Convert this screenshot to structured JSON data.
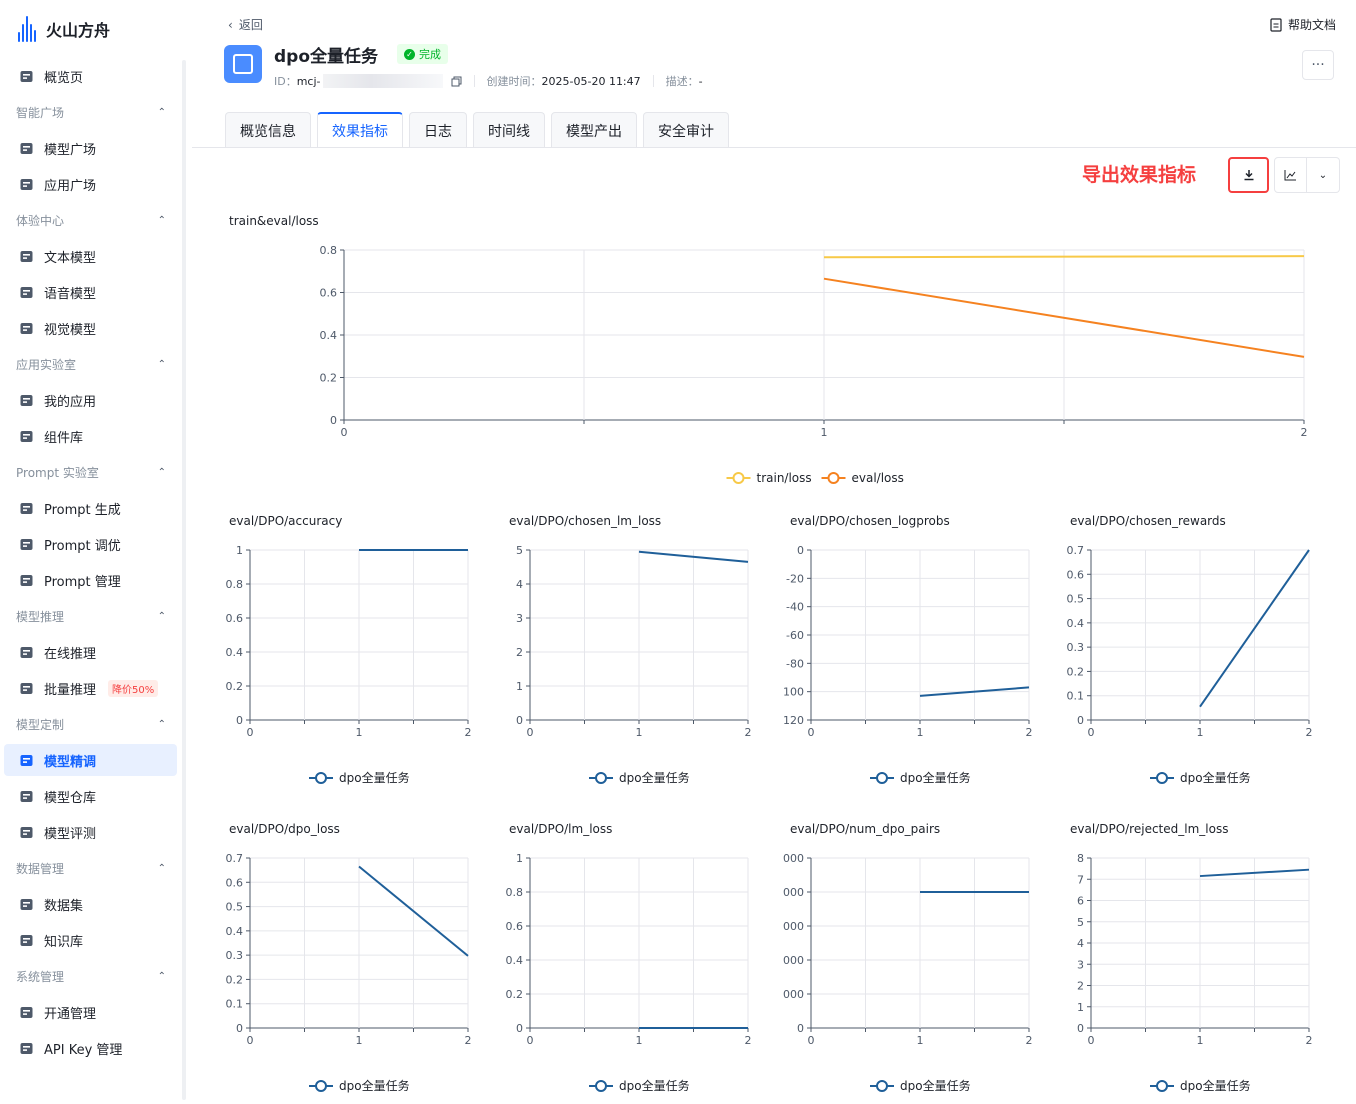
{
  "sidebar": {
    "logo_text": "火山方舟",
    "items": [
      {
        "type": "item",
        "label": "概览页",
        "icon": "dashboard-icon"
      },
      {
        "type": "group",
        "label": "智能广场"
      },
      {
        "type": "item",
        "label": "模型广场",
        "icon": "bulb-icon"
      },
      {
        "type": "item",
        "label": "应用广场",
        "icon": "atom-icon"
      },
      {
        "type": "group",
        "label": "体验中心"
      },
      {
        "type": "item",
        "label": "文本模型",
        "icon": "archive-icon"
      },
      {
        "type": "item",
        "label": "语音模型",
        "icon": "mic-icon"
      },
      {
        "type": "item",
        "label": "视觉模型",
        "icon": "camera-icon"
      },
      {
        "type": "group",
        "label": "应用实验室"
      },
      {
        "type": "item",
        "label": "我的应用",
        "icon": "apps-icon"
      },
      {
        "type": "item",
        "label": "组件库",
        "icon": "stack-icon"
      },
      {
        "type": "group",
        "label": "Prompt 实验室"
      },
      {
        "type": "item",
        "label": "Prompt 生成",
        "icon": "terminal-icon"
      },
      {
        "type": "item",
        "label": "Prompt 调优",
        "icon": "tune-icon"
      },
      {
        "type": "item",
        "label": "Prompt 管理",
        "icon": "message-icon"
      },
      {
        "type": "group",
        "label": "模型推理"
      },
      {
        "type": "item",
        "label": "在线推理",
        "icon": "building-icon"
      },
      {
        "type": "item",
        "label": "批量推理",
        "icon": "rocket-icon",
        "badge": "降价50%"
      },
      {
        "type": "group",
        "label": "模型定制"
      },
      {
        "type": "item",
        "label": "模型精调",
        "icon": "finetune-icon",
        "active": true
      },
      {
        "type": "item",
        "label": "模型仓库",
        "icon": "cube-icon"
      },
      {
        "type": "item",
        "label": "模型评测",
        "icon": "flask-icon"
      },
      {
        "type": "group",
        "label": "数据管理"
      },
      {
        "type": "item",
        "label": "数据集",
        "icon": "bar-chart-icon"
      },
      {
        "type": "item",
        "label": "知识库",
        "icon": "server-icon"
      },
      {
        "type": "group",
        "label": "系统管理"
      },
      {
        "type": "item",
        "label": "开通管理",
        "icon": "list-icon"
      },
      {
        "type": "item",
        "label": "API Key 管理",
        "icon": "shield-icon"
      }
    ]
  },
  "header": {
    "back_label": "返回",
    "help_label": "帮助文档",
    "title": "dpo全量任务",
    "status": "完成",
    "id_label": "ID：",
    "id_value": "mcj-",
    "created_label": "创建时间：",
    "created_value": "2025-05-20 11:47",
    "desc_label": "描述：",
    "desc_value": "-",
    "more_label": "···"
  },
  "tabs": [
    "概览信息",
    "效果指标",
    "日志",
    "时间线",
    "模型产出",
    "安全审计"
  ],
  "active_tab": 1,
  "export_label": "导出效果指标",
  "colors": {
    "accent": "#1664ff",
    "train": "#f7c948",
    "eval": "#f58220",
    "series": "#1f5f99",
    "annotation": "#f53f3f"
  },
  "chart_data": [
    {
      "type": "line",
      "title": "train&eval/loss",
      "x": [
        0,
        1,
        2
      ],
      "xlim": [
        0,
        2
      ],
      "ylim": [
        0,
        0.8
      ],
      "yticks": [
        0,
        0.2,
        0.4,
        0.6,
        0.8
      ],
      "series": [
        {
          "name": "train/loss",
          "x": [
            1,
            2
          ],
          "values": [
            0.766,
            0.771
          ]
        },
        {
          "name": "eval/loss",
          "x": [
            1,
            2
          ],
          "values": [
            0.665,
            0.297
          ]
        }
      ],
      "legend": "bottom"
    },
    {
      "type": "line",
      "title": "eval/DPO/accuracy",
      "xlim": [
        0,
        2
      ],
      "ylim": [
        0,
        1
      ],
      "yticks": [
        "0",
        "0.2",
        "0.4",
        "0.6",
        "0.8",
        "1"
      ],
      "series": [
        {
          "name": "dpo全量任务",
          "x": [
            1,
            2
          ],
          "values": [
            1,
            1
          ]
        }
      ]
    },
    {
      "type": "line",
      "title": "eval/DPO/chosen_lm_loss",
      "xlim": [
        0,
        2
      ],
      "ylim": [
        0,
        5
      ],
      "yticks": [
        "0",
        "1",
        "2",
        "3",
        "4",
        "5"
      ],
      "series": [
        {
          "name": "dpo全量任务",
          "x": [
            1,
            2
          ],
          "values": [
            4.95,
            4.65
          ]
        }
      ]
    },
    {
      "type": "line",
      "title": "eval/DPO/chosen_logprobs",
      "xlim": [
        0,
        2
      ],
      "ylim": [
        -120,
        0
      ],
      "yticks": [
        "120",
        "100",
        "-80",
        "-60",
        "-40",
        "-20",
        "0"
      ],
      "series": [
        {
          "name": "dpo全量任务",
          "x": [
            1,
            2
          ],
          "values": [
            -103,
            -97
          ]
        }
      ]
    },
    {
      "type": "line",
      "title": "eval/DPO/chosen_rewards",
      "xlim": [
        0,
        2
      ],
      "ylim": [
        0,
        0.7
      ],
      "yticks": [
        "0",
        "0.1",
        "0.2",
        "0.3",
        "0.4",
        "0.5",
        "0.6",
        "0.7"
      ],
      "series": [
        {
          "name": "dpo全量任务",
          "x": [
            1,
            2
          ],
          "values": [
            0.055,
            0.7
          ]
        }
      ]
    },
    {
      "type": "line",
      "title": "eval/DPO/dpo_loss",
      "xlim": [
        0,
        2
      ],
      "ylim": [
        0,
        0.7
      ],
      "yticks": [
        "0",
        "0.1",
        "0.2",
        "0.3",
        "0.4",
        "0.5",
        "0.6",
        "0.7"
      ],
      "series": [
        {
          "name": "dpo全量任务",
          "x": [
            1,
            2
          ],
          "values": [
            0.665,
            0.297
          ]
        }
      ]
    },
    {
      "type": "line",
      "title": "eval/DPO/lm_loss",
      "xlim": [
        0,
        2
      ],
      "ylim": [
        0,
        1
      ],
      "yticks": [
        "0",
        "0.2",
        "0.4",
        "0.6",
        "0.8",
        "1"
      ],
      "series": [
        {
          "name": "dpo全量任务",
          "x": [
            1,
            2
          ],
          "values": [
            0,
            0
          ]
        }
      ]
    },
    {
      "type": "line",
      "title": "eval/DPO/num_dpo_pairs",
      "xlim": [
        0,
        2
      ],
      "ylim": [
        0,
        5
      ],
      "yticks": [
        "0",
        "000",
        "000",
        "000",
        "000",
        "000"
      ],
      "series": [
        {
          "name": "dpo全量任务",
          "x": [
            1,
            2
          ],
          "values": [
            4,
            4
          ]
        }
      ]
    },
    {
      "type": "line",
      "title": "eval/DPO/rejected_lm_loss",
      "xlim": [
        0,
        2
      ],
      "ylim": [
        0,
        8
      ],
      "yticks": [
        "0",
        "1",
        "2",
        "3",
        "4",
        "5",
        "6",
        "7",
        "8"
      ],
      "series": [
        {
          "name": "dpo全量任务",
          "x": [
            1,
            2
          ],
          "values": [
            7.15,
            7.45
          ]
        }
      ]
    }
  ]
}
